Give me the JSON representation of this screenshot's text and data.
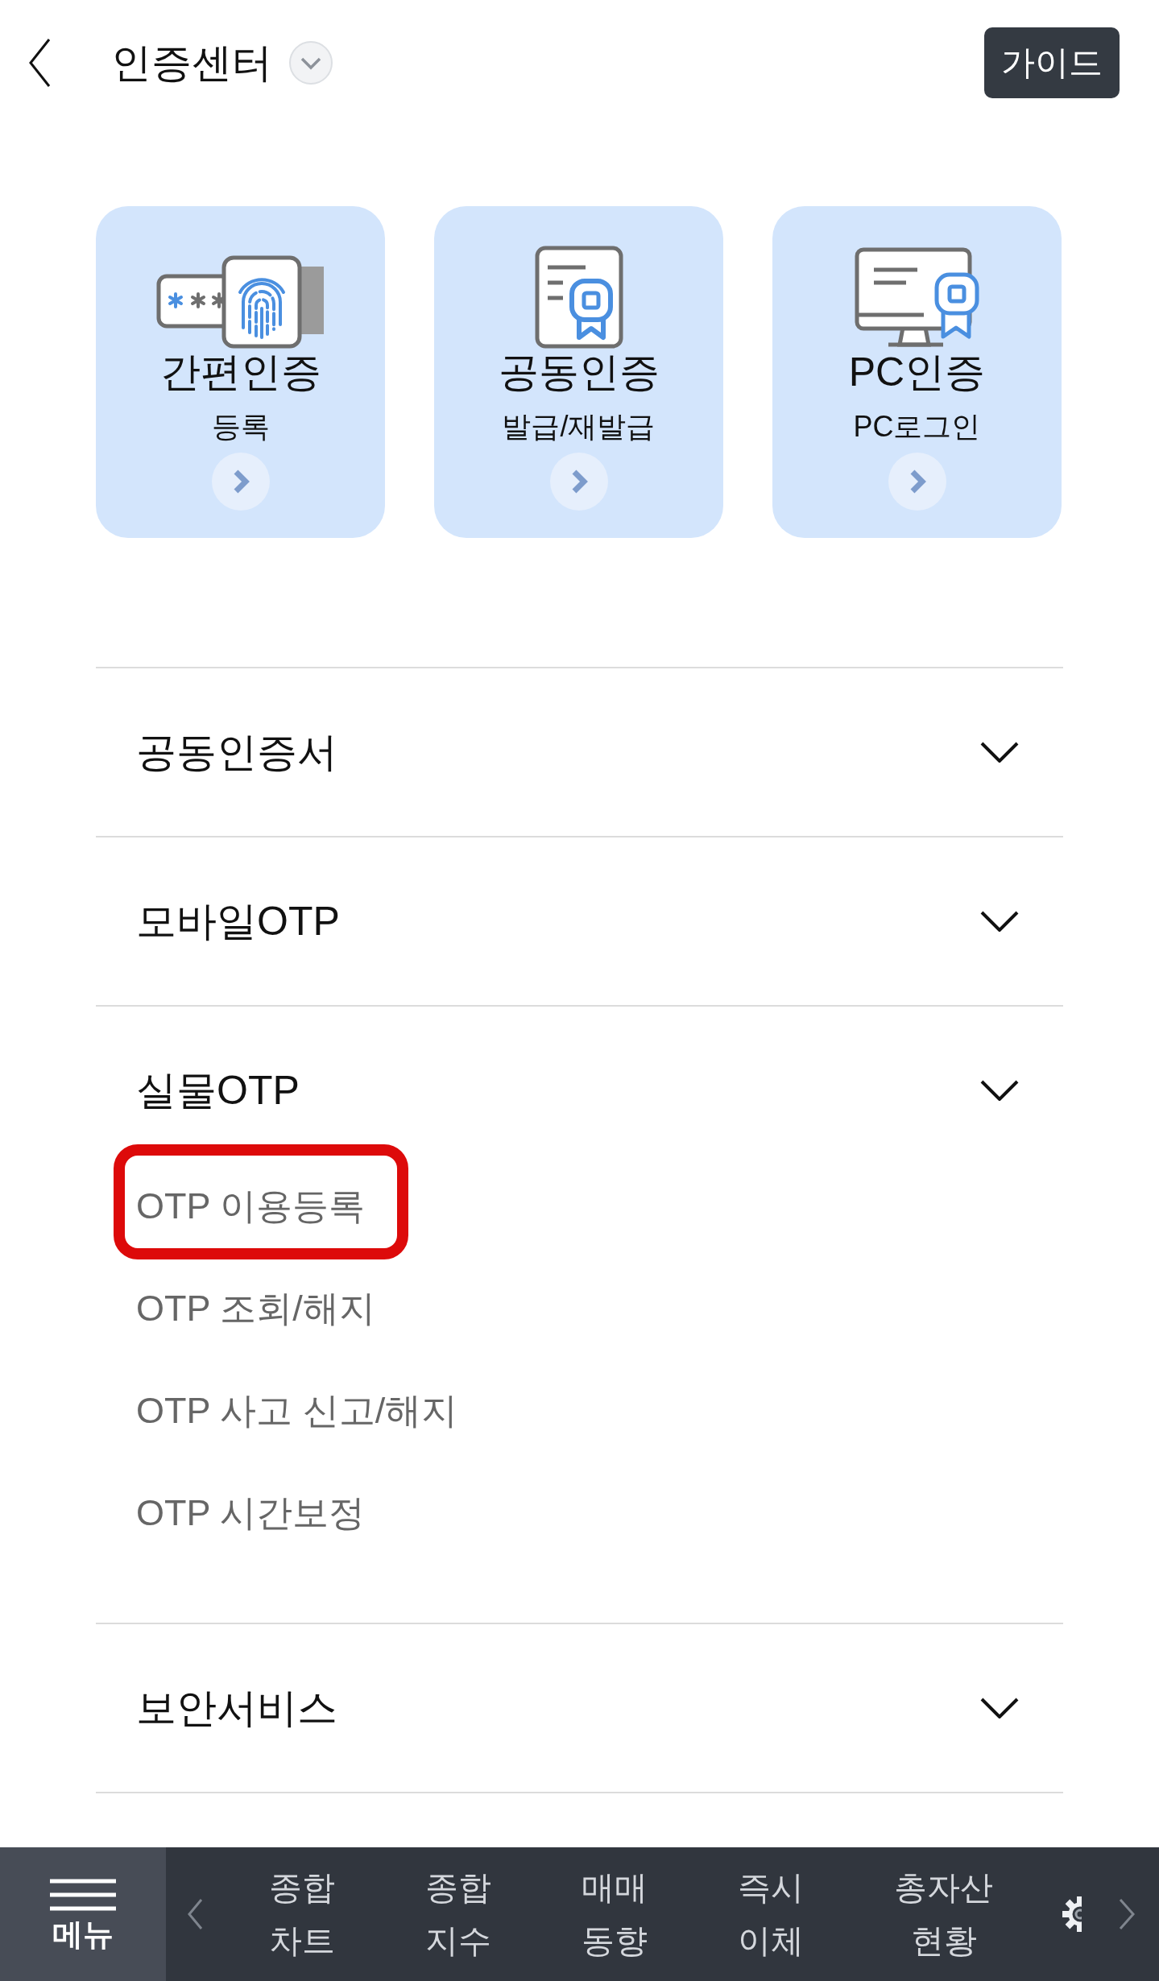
{
  "header": {
    "title": "인증센터",
    "guide_button": "가이드"
  },
  "cards": [
    {
      "kind": "fingerprint",
      "title": "간편인증",
      "subtitle": "등록"
    },
    {
      "kind": "certificate",
      "title": "공동인증",
      "subtitle": "발급/재발급"
    },
    {
      "kind": "pc",
      "title": "PC인증",
      "subtitle": "PC로그인"
    }
  ],
  "sections": [
    {
      "title": "공동인증서"
    },
    {
      "title": "모바일OTP"
    },
    {
      "title": "실물OTP",
      "items": [
        {
          "label": "OTP 이용등록",
          "highlighted": true
        },
        {
          "label": "OTP 조회/해지",
          "highlighted": false
        },
        {
          "label": "OTP 사고 신고/해지",
          "highlighted": false
        },
        {
          "label": "OTP 시간보정",
          "highlighted": false
        }
      ]
    },
    {
      "title": "보안서비스"
    }
  ],
  "bottom_nav": {
    "menu_label": "메뉴",
    "items": [
      "종합\n차트",
      "종합\n지수",
      "매매\n동향",
      "즉시\n이체",
      "총자산\n현황"
    ]
  }
}
